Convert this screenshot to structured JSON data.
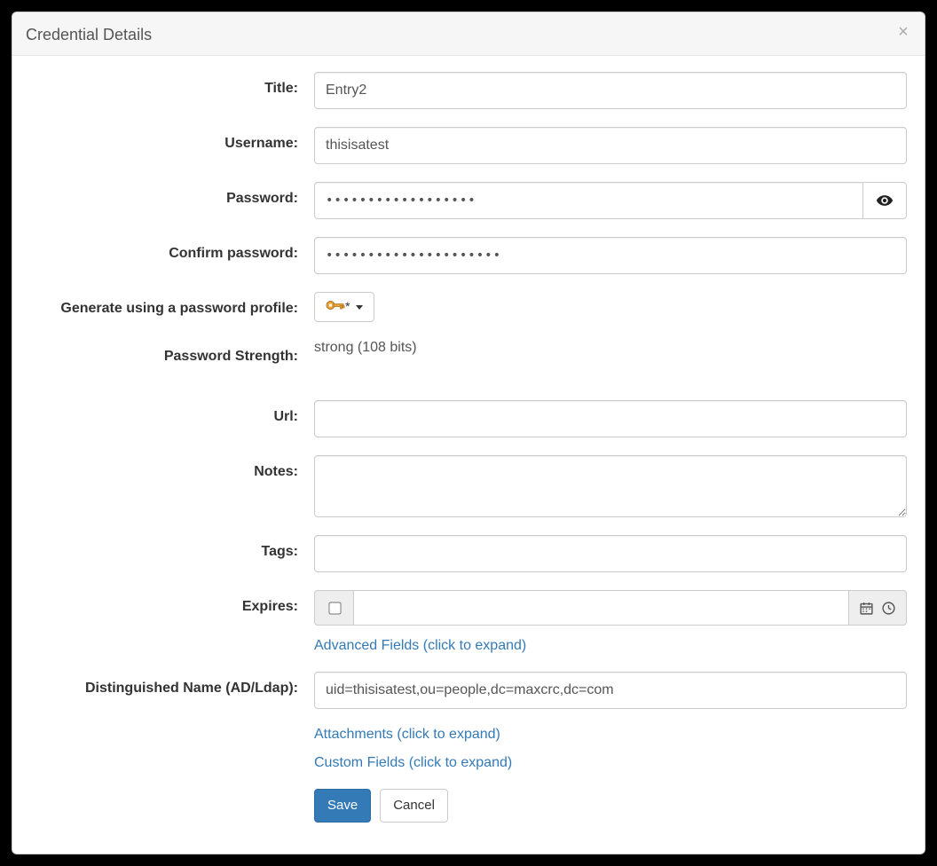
{
  "modal": {
    "title": "Credential Details"
  },
  "labels": {
    "title": "Title:",
    "username": "Username:",
    "password": "Password:",
    "confirm_password": "Confirm password:",
    "generate_profile": "Generate using a password profile:",
    "password_strength": "Password Strength:",
    "url": "Url:",
    "notes": "Notes:",
    "tags": "Tags:",
    "expires": "Expires:",
    "distinguished_name": "Distinguished Name (AD/Ldap):"
  },
  "values": {
    "title": "Entry2",
    "username": "thisisatest",
    "password_mask": "••••••••••••••••••",
    "confirm_password_mask": "•••••••••••••••••••••",
    "password_strength": "strong (108 bits)",
    "url": "",
    "notes": "",
    "tags": "",
    "expires": "",
    "distinguished_name": "uid=thisisatest,ou=people,dc=maxcrc,dc=com"
  },
  "generate": {
    "suffix": "*"
  },
  "links": {
    "advanced_fields": "Advanced Fields (click to expand)",
    "attachments": "Attachments (click to expand)",
    "custom_fields": "Custom Fields (click to expand)"
  },
  "buttons": {
    "save": "Save",
    "cancel": "Cancel"
  }
}
